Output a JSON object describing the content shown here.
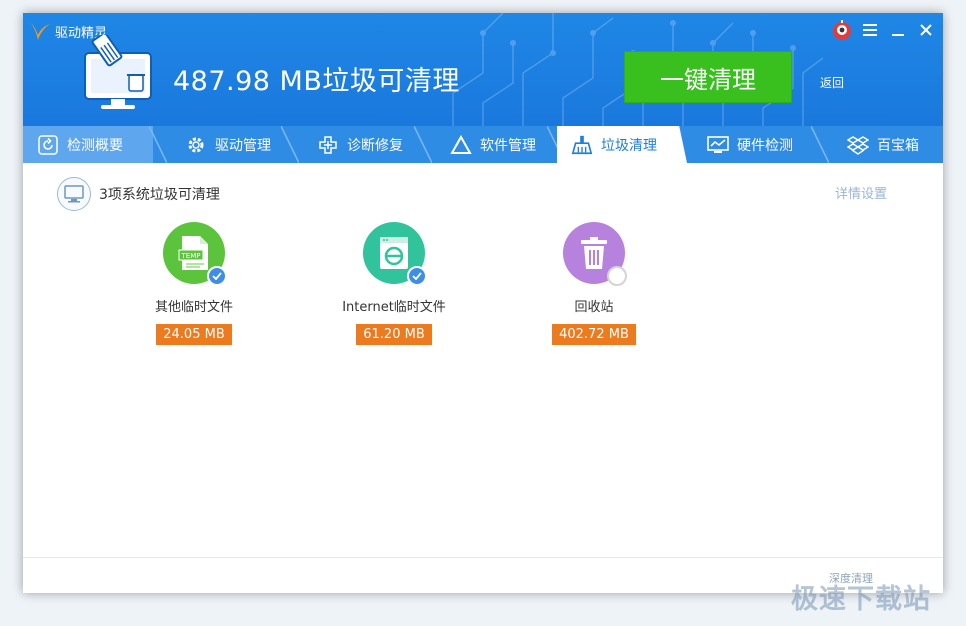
{
  "app": {
    "name": "驱动精灵"
  },
  "header": {
    "summary": "487.98 MB垃圾可清理",
    "clean_button": "一键清理",
    "back_link": "返回"
  },
  "tabs": [
    {
      "label": "检测概要",
      "icon": "refresh-icon"
    },
    {
      "label": "驱动管理",
      "icon": "gear-icon"
    },
    {
      "label": "诊断修复",
      "icon": "medical-cross-icon"
    },
    {
      "label": "软件管理",
      "icon": "triangle-apps-icon"
    },
    {
      "label": "垃圾清理",
      "icon": "broom-icon",
      "active": true
    },
    {
      "label": "硬件检测",
      "icon": "monitor-chart-icon"
    },
    {
      "label": "百宝箱",
      "icon": "toolbox-icon"
    }
  ],
  "section": {
    "title": "3项系统垃圾可清理",
    "detail_link": "详情设置"
  },
  "items": [
    {
      "label": "其他临时文件",
      "size": "24.05 MB",
      "icon_text": "TEMP",
      "icon": "temp-file-icon",
      "checked": true,
      "color": "#5cc43c"
    },
    {
      "label": "Internet临时文件",
      "size": "61.20 MB",
      "icon": "browser-file-icon",
      "checked": true,
      "color": "#31c39c"
    },
    {
      "label": "回收站",
      "size": "402.72 MB",
      "icon": "trash-icon",
      "checked": false,
      "color": "#b782dd"
    }
  ],
  "footer": {
    "deep_clean_link": "深度清理"
  },
  "watermark": "极速下载站",
  "colors": {
    "header_blue": "#1f87e6",
    "tab_bar": "#2f8ce5",
    "clean_green": "#39c01f",
    "size_orange": "#ec7a1e",
    "check_blue": "#3f8ee6"
  }
}
